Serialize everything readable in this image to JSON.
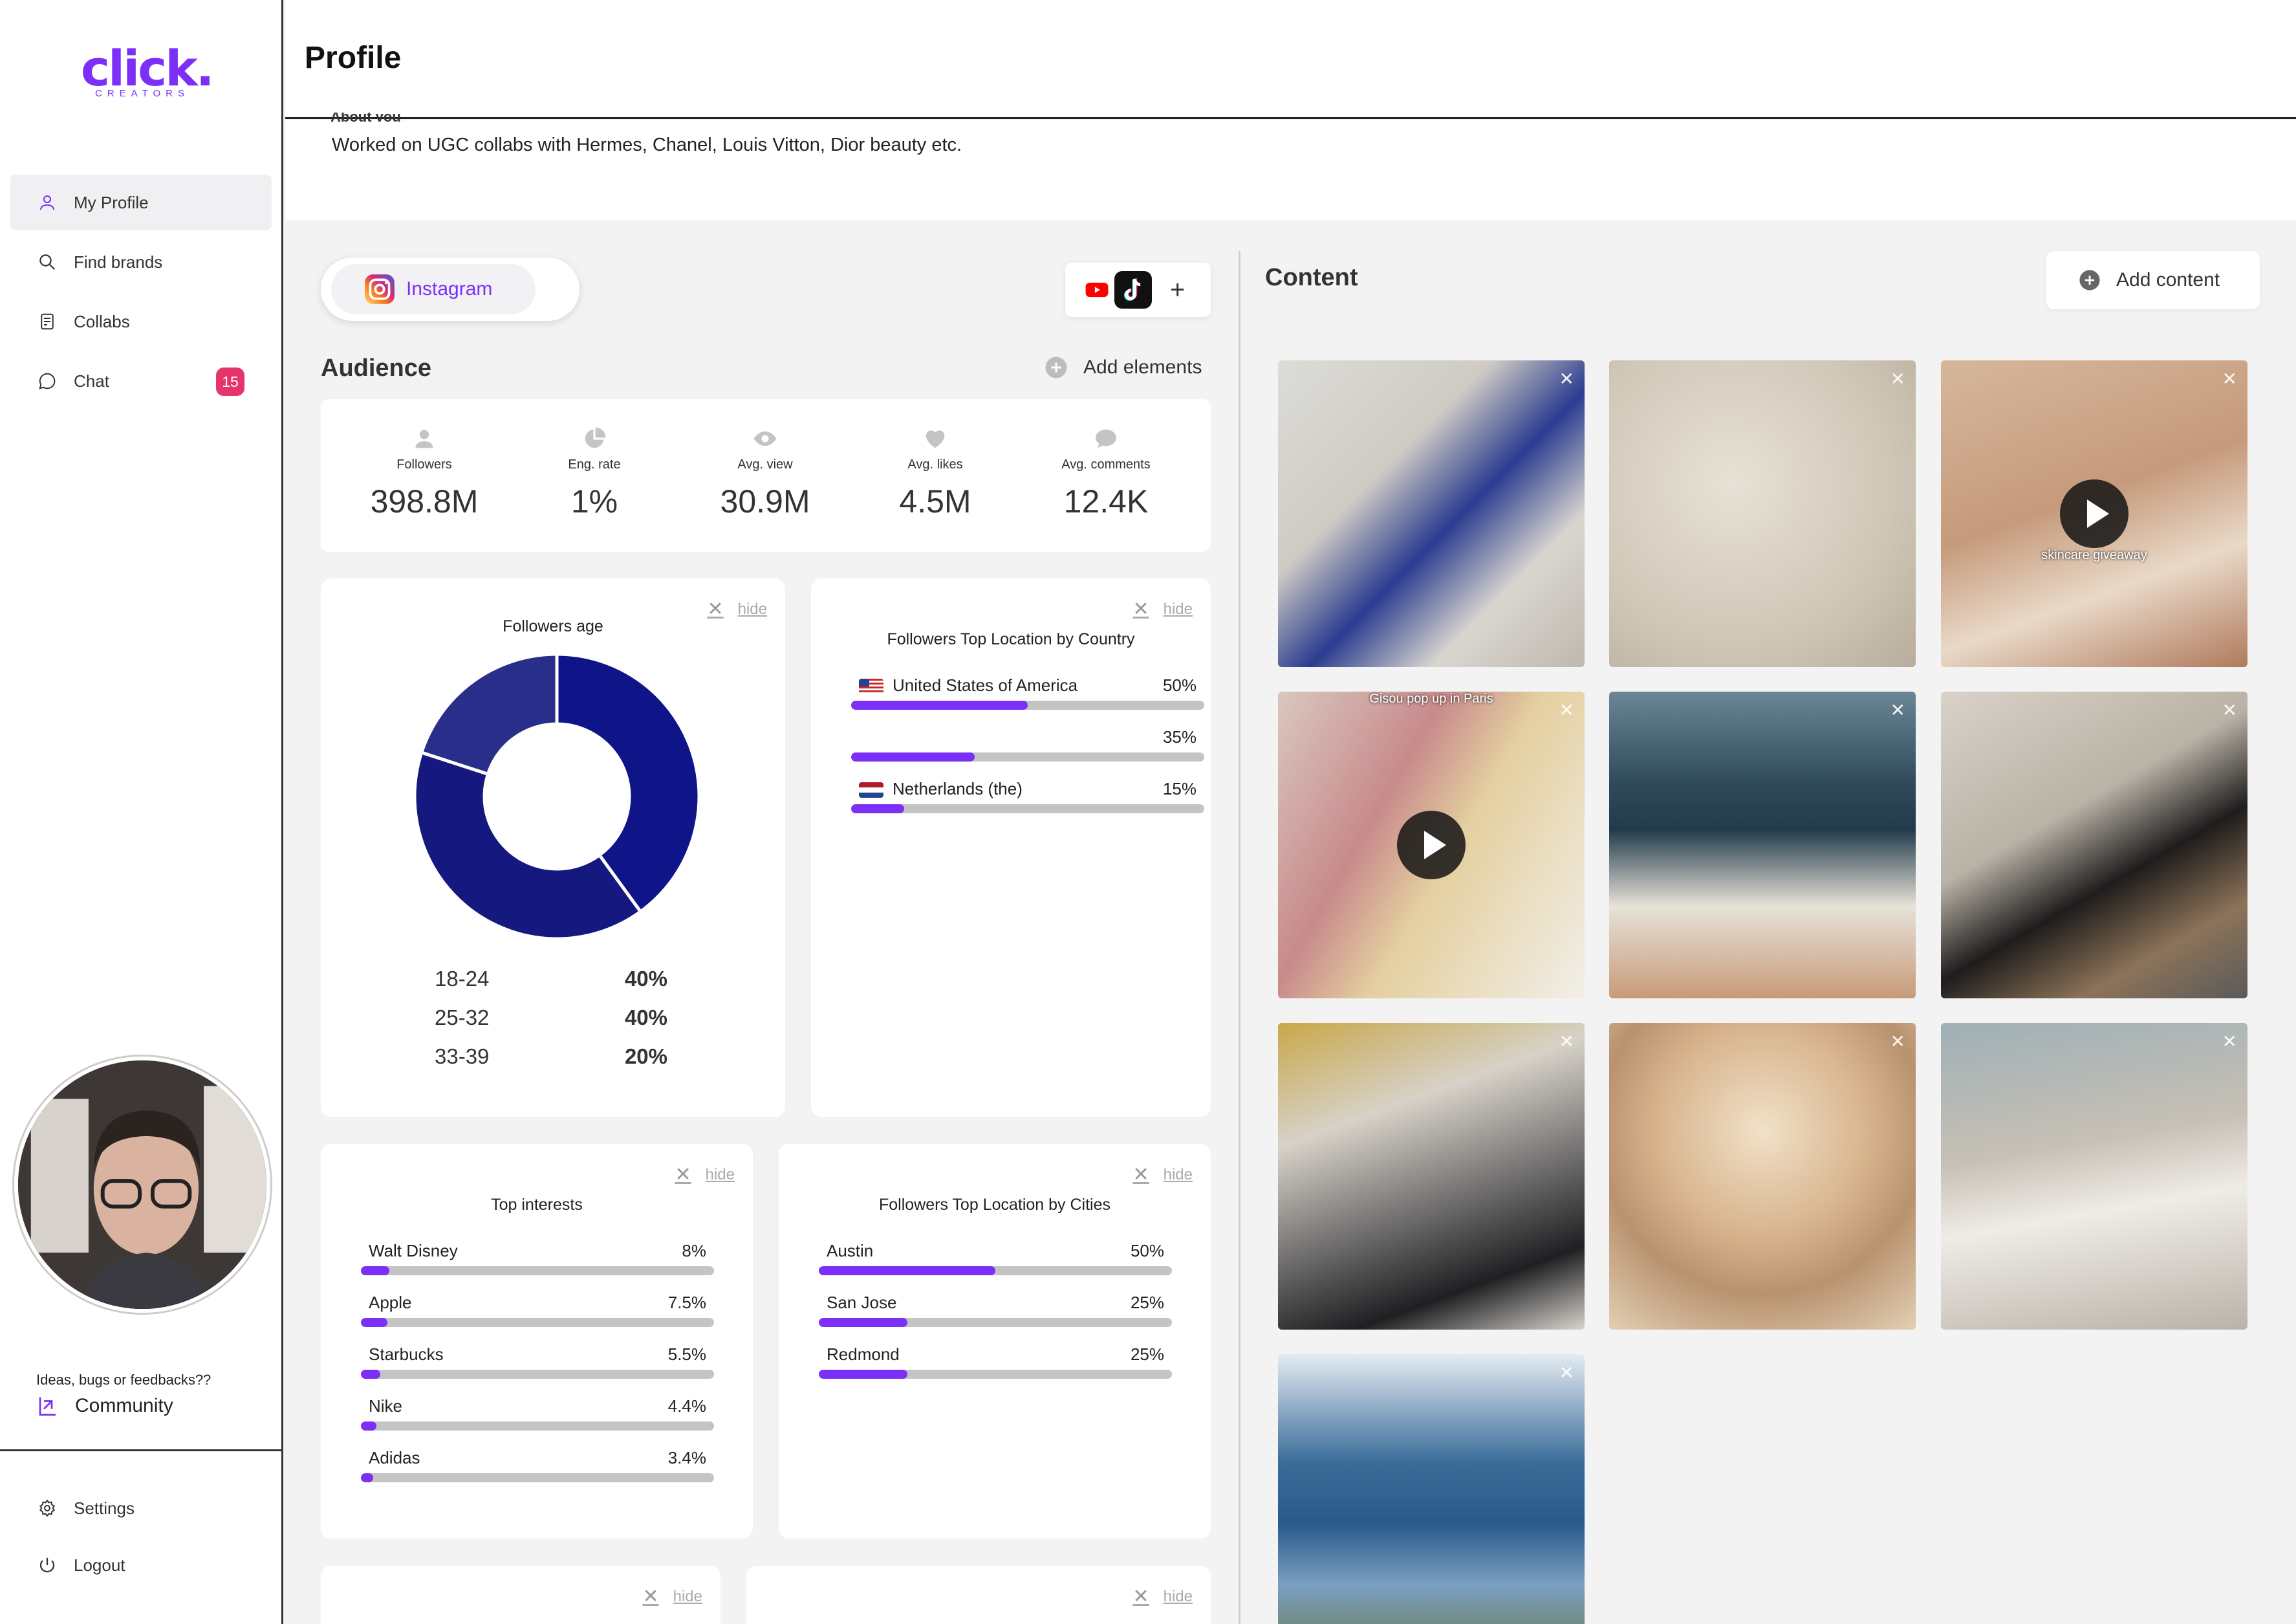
{
  "app": {
    "logo_text": "click.",
    "logo_sub": "CREATORS"
  },
  "sidebar": {
    "items": [
      {
        "label": "My Profile",
        "icon": "user-icon"
      },
      {
        "label": "Find brands",
        "icon": "search-icon"
      },
      {
        "label": "Collabs",
        "icon": "document-icon"
      },
      {
        "label": "Chat",
        "icon": "chat-icon",
        "badge": "15"
      }
    ],
    "feedback": "Ideas, bugs or feedbacks??",
    "community": "Community",
    "settings": "Settings",
    "logout": "Logout"
  },
  "header": {
    "title": "Profile"
  },
  "about": {
    "label": "About you",
    "text": "Worked on UGC collabs with Hermes, Chanel, Louis Vitton, Dior beauty etc."
  },
  "platform": {
    "active": "Instagram"
  },
  "audience": {
    "title": "Audience",
    "add_elements": "Add elements",
    "stats": [
      {
        "label": "Followers",
        "value": "398.8M",
        "icon": "user-icon"
      },
      {
        "label": "Eng. rate",
        "value": "1%",
        "icon": "pie-icon"
      },
      {
        "label": "Avg. view",
        "value": "30.9M",
        "icon": "eye-icon"
      },
      {
        "label": "Avg. likes",
        "value": "4.5M",
        "icon": "heart-icon"
      },
      {
        "label": "Avg. comments",
        "value": "12.4K",
        "icon": "comment-icon"
      }
    ]
  },
  "hide_label": "hide",
  "followers_age": {
    "title": "Followers age",
    "rows": [
      {
        "range": "18-24",
        "pct": "40%",
        "value": 40
      },
      {
        "range": "25-32",
        "pct": "40%",
        "value": 40
      },
      {
        "range": "33-39",
        "pct": "20%",
        "value": 20
      }
    ],
    "colors": [
      "#0f1589",
      "#15197f",
      "#292e8a"
    ]
  },
  "top_country": {
    "title": "Followers Top Location by Country",
    "rows": [
      {
        "name": "United States of America",
        "pct": "50%",
        "value": 50,
        "flag": "us"
      },
      {
        "name": "",
        "pct": "35%",
        "value": 35,
        "flag": ""
      },
      {
        "name": "Netherlands (the)",
        "pct": "15%",
        "value": 15,
        "flag": "nl"
      }
    ]
  },
  "top_interests": {
    "title": "Top interests",
    "rows": [
      {
        "name": "Walt Disney",
        "pct": "8%",
        "value": 8
      },
      {
        "name": "Apple",
        "pct": "7.5%",
        "value": 7.5
      },
      {
        "name": "Starbucks",
        "pct": "5.5%",
        "value": 5.5
      },
      {
        "name": "Nike",
        "pct": "4.4%",
        "value": 4.4
      },
      {
        "name": "Adidas",
        "pct": "3.4%",
        "value": 3.4
      }
    ]
  },
  "top_cities": {
    "title": "Followers Top Location by Cities",
    "rows": [
      {
        "name": "Austin",
        "pct": "50%",
        "value": 50
      },
      {
        "name": "San Jose",
        "pct": "25%",
        "value": 25
      },
      {
        "name": "Redmond",
        "pct": "25%",
        "value": 25
      }
    ]
  },
  "content": {
    "title": "Content",
    "add_content": "Add content",
    "items": [
      {
        "type": "image",
        "caption": ""
      },
      {
        "type": "image",
        "caption": ""
      },
      {
        "type": "video",
        "caption": "skincare giveaway"
      },
      {
        "type": "video",
        "caption": "Gisou pop up in Paris"
      },
      {
        "type": "image",
        "caption": ""
      },
      {
        "type": "image",
        "caption": ""
      },
      {
        "type": "image",
        "caption": ""
      },
      {
        "type": "image",
        "caption": ""
      },
      {
        "type": "image",
        "caption": ""
      },
      {
        "type": "image",
        "caption": ""
      }
    ]
  },
  "colors": {
    "accent": "#7b2ff7",
    "badge": "#e5356b",
    "donut": "#0f1589"
  }
}
